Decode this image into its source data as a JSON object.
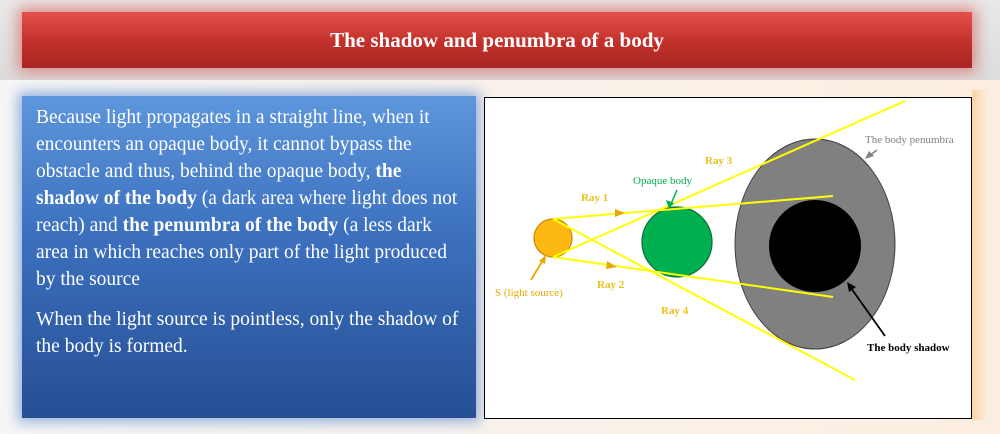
{
  "title": "The shadow and penumbra of a body",
  "paragraph1": {
    "part1": "Because light propagates in a straight line, when it encounters an opaque body, it cannot bypass the obstacle and thus, behind the opaque body, ",
    "bold1": "the shadow of the body",
    "part2": " (a dark area where light does not reach) and ",
    "bold2": "the penumbra of the body",
    "part3": " (a less dark area in which reaches only part of the light produced by the source"
  },
  "paragraph2": "When the light source is pointless, only the shadow of the body is formed.",
  "diagram": {
    "labels": {
      "penumbra": "The body penumbra",
      "opaque_body": "Opaque body",
      "ray1": "Ray 1",
      "ray2": "Ray 2",
      "ray3": "Ray 3",
      "ray4": "Ray 4",
      "source": "S (light source)",
      "shadow": "The body shadow"
    },
    "colors": {
      "source": "#fdb813",
      "opaque_body": "#00b050",
      "penumbra": "#808080",
      "shadow": "#000000",
      "ray": "#ffff00",
      "ray_label": "#e8c21a",
      "opaque_label": "#00b050",
      "penumbra_label": "#808080"
    }
  }
}
